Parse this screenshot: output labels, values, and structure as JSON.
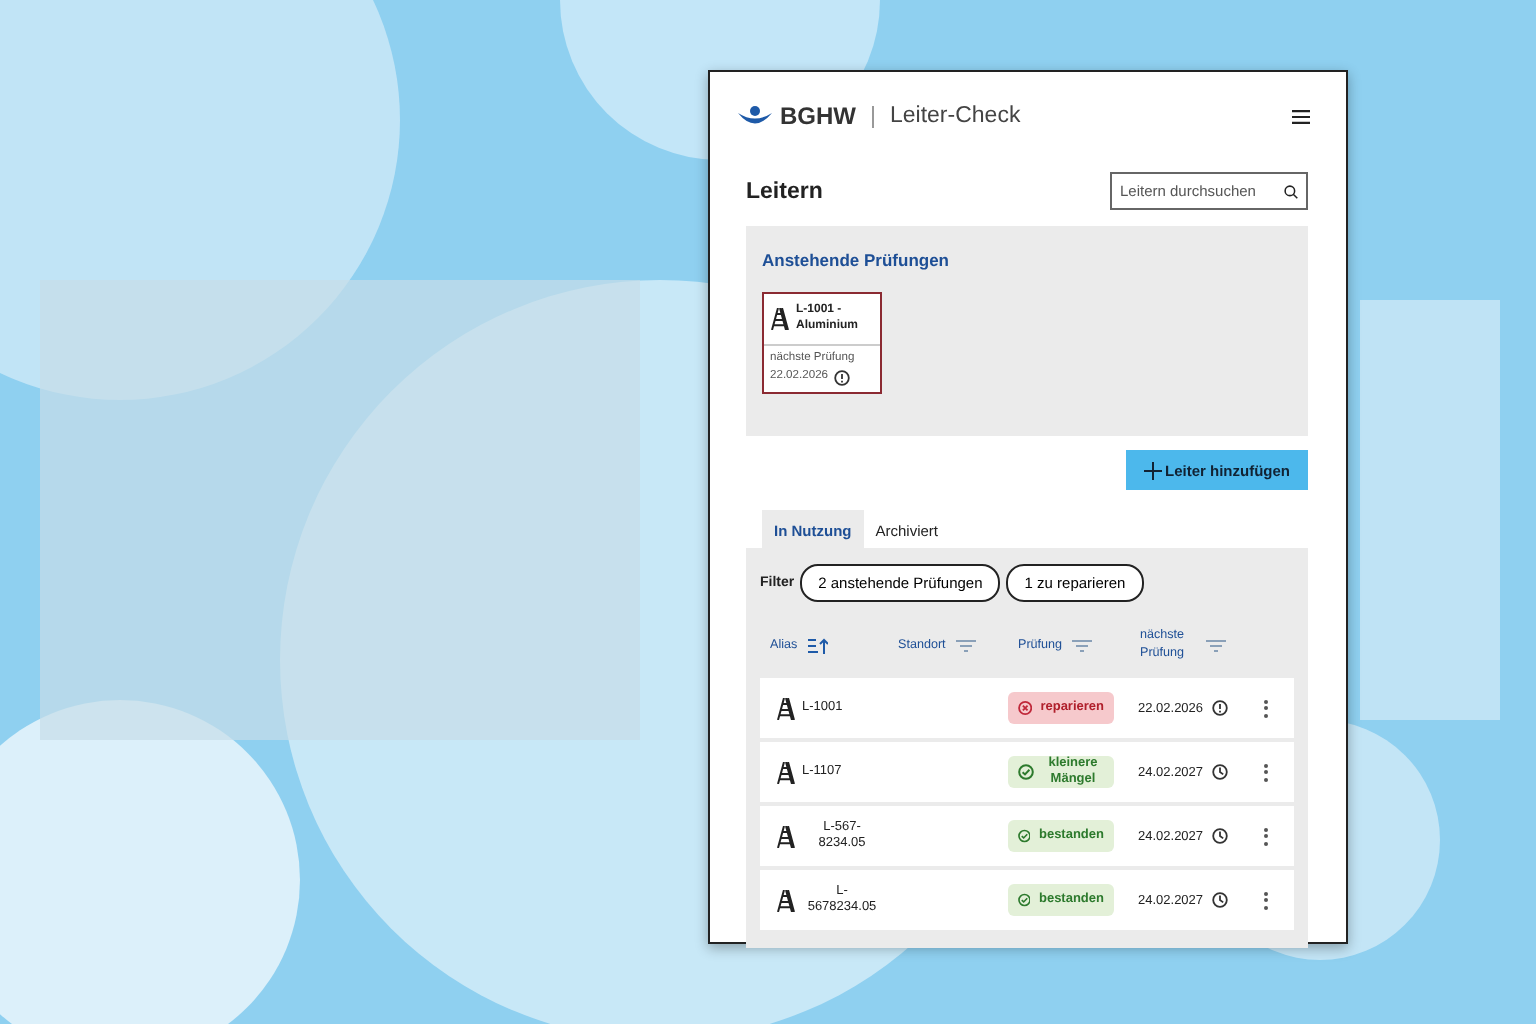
{
  "header": {
    "logo": "BGHW",
    "app_name": "Leiter-Check"
  },
  "page_title": "Leitern",
  "search": {
    "placeholder": "Leitern durchsuchen"
  },
  "pending": {
    "title": "Anstehende Prüfungen",
    "cards": [
      {
        "name": "L-1001 - Aluminium",
        "label": "nächste Prüfung",
        "date": "22.02.2026"
      }
    ]
  },
  "add_button": "Leiter hinzufügen",
  "tabs": [
    {
      "label": "In Nutzung",
      "selected": true
    },
    {
      "label": "Archiviert",
      "selected": false
    }
  ],
  "filter": {
    "label": "Filter",
    "chips": [
      "2 anstehende Prüfungen",
      "1 zu reparieren"
    ]
  },
  "table": {
    "columns": [
      {
        "label": "Alias",
        "kind": "sort"
      },
      {
        "label": "Standort",
        "kind": "filter"
      },
      {
        "label": "Prüfung",
        "kind": "filter"
      },
      {
        "label": "nächste Prüfung",
        "kind": "filter"
      }
    ],
    "rows": [
      {
        "alias": "L-1001",
        "status": {
          "kind": "repair",
          "label": "reparieren"
        },
        "date": "22.02.2026",
        "due": true
      },
      {
        "alias": "L-1107",
        "status": {
          "kind": "ok",
          "label": "kleinere Mängel"
        },
        "date": "24.02.2027",
        "due": false
      },
      {
        "alias": "L-567-8234.05",
        "status": {
          "kind": "ok",
          "label": "bestanden"
        },
        "date": "24.02.2027",
        "due": false
      },
      {
        "alias": "L-5678234.05",
        "status": {
          "kind": "ok",
          "label": "bestanden"
        },
        "date": "24.02.2027",
        "due": false
      }
    ]
  }
}
